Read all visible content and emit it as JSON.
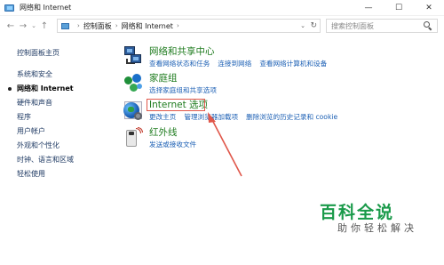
{
  "window": {
    "title": "网络和 Internet",
    "minimize": "—",
    "maximize": "☐",
    "close": "✕"
  },
  "nav": {
    "back": "←",
    "forward": "→",
    "recent": "⌄",
    "up": "↑"
  },
  "address": {
    "sep1": "›",
    "crumb1": "控制面板",
    "sep2": "›",
    "crumb2": "网络和 Internet",
    "sep3": "›",
    "dropdown": "⌄",
    "refresh": "↻"
  },
  "search": {
    "placeholder": "搜索控制面板"
  },
  "sidebar": {
    "items": [
      {
        "label": "控制面板主页"
      },
      {
        "label": "系统和安全"
      },
      {
        "label": "网络和 Internet"
      },
      {
        "label": "硬件和声音"
      },
      {
        "label": "程序"
      },
      {
        "label": "用户帐户"
      },
      {
        "label": "外观和个性化"
      },
      {
        "label": "时钟、语言和区域"
      },
      {
        "label": "轻松使用"
      }
    ]
  },
  "categories": {
    "network": {
      "title": "网络和共享中心",
      "links": [
        "查看网络状态和任务",
        "连接到网络",
        "查看网络计算机和设备"
      ]
    },
    "homegroup": {
      "title": "家庭组",
      "links": [
        "选择家庭组和共享选项"
      ]
    },
    "internet": {
      "title": "Internet 选项",
      "links": [
        "更改主页",
        "管理浏览器加载项",
        "删除浏览的历史记录和 cookie"
      ]
    },
    "infrared": {
      "title": "红外线",
      "links": [
        "发送或接收文件"
      ]
    }
  },
  "watermark": {
    "title": "百科全说",
    "subtitle": "助你轻松解决"
  },
  "colors": {
    "category_title": "#1e7b1e",
    "link": "#1b5fb4",
    "highlight": "#e0574a",
    "watermark": "#1a9a4a"
  }
}
